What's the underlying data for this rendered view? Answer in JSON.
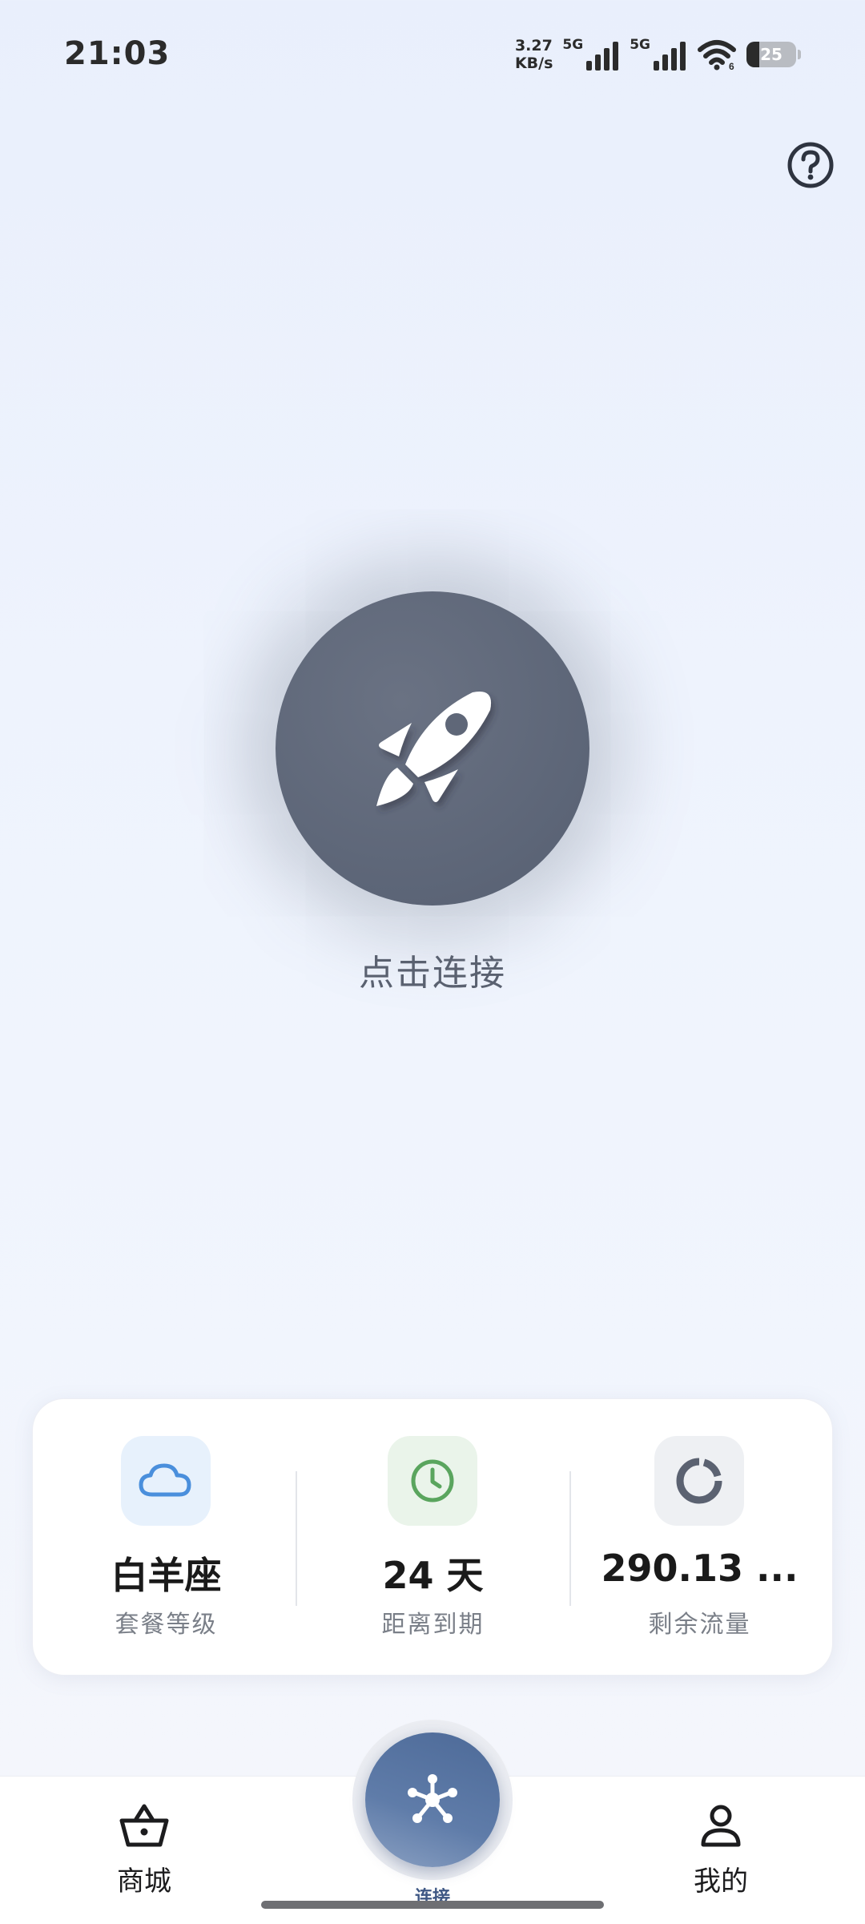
{
  "status_bar": {
    "time": "21:03",
    "net_speed_value": "3.27",
    "net_speed_unit": "KB/s",
    "sim1_tag": "5G",
    "sim2_tag": "5G",
    "battery_level": "25",
    "battery_fraction": 0.25
  },
  "connect": {
    "label": "点击连接",
    "icon": "rocket-icon"
  },
  "info_card": {
    "plan": {
      "value": "白羊座",
      "caption": "套餐等级",
      "icon": "cloud-icon",
      "icon_bg": "#e7f1fc",
      "icon_color": "#4a8fdc"
    },
    "expiry": {
      "value": "24 天",
      "caption": "距离到期",
      "icon": "clock-icon",
      "icon_bg": "#eaf4ea",
      "icon_color": "#5aa55e"
    },
    "traffic": {
      "value": "290.13 ...",
      "caption": "剩余流量",
      "icon": "donut-chart-icon",
      "icon_bg": "#eef0f3",
      "icon_color": "#5b6271"
    }
  },
  "bottom_nav": {
    "shop_label": "商城",
    "connect_label": "连接",
    "profile_label": "我的"
  },
  "colors": {
    "accent": "#5a77a5",
    "connect_button": "#5f6778"
  }
}
